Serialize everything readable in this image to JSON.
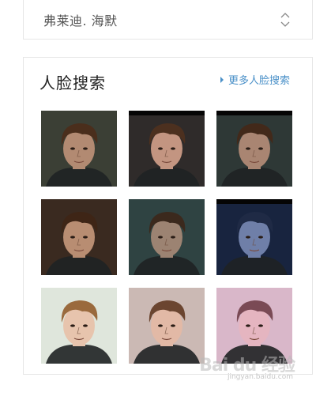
{
  "select": {
    "value": "弗莱迪. 海默",
    "icon": "sort-updown-icon"
  },
  "face_search": {
    "title": "人脸搜索",
    "more_label": "更多人脸搜索",
    "results": [
      {
        "tone": "dark-interior",
        "bg": "#3b3f35",
        "skin": "#b28a72",
        "hair": "#4a2e1c",
        "top_band": false
      },
      {
        "tone": "letterbox",
        "bg": "#2f2b2a",
        "skin": "#c39581",
        "hair": "#4c301f",
        "top_band": true
      },
      {
        "tone": "dark-teal",
        "bg": "#2e3836",
        "skin": "#a98572",
        "hair": "#42291a",
        "top_band": true
      },
      {
        "tone": "closeup-warm",
        "bg": "#3a2a20",
        "skin": "#b88d72",
        "hair": "#3e2516",
        "top_band": false
      },
      {
        "tone": "teal-interior",
        "bg": "#2f4342",
        "skin": "#9c8372",
        "hair": "#3b291d",
        "top_band": false
      },
      {
        "tone": "blue-night",
        "bg": "#18243f",
        "skin": "#6f7fa8",
        "hair": "#1f2a45",
        "top_band": true
      },
      {
        "tone": "washed-light",
        "bg": "#dfe6dc",
        "skin": "#e7c4ad",
        "hair": "#9a6a3d",
        "top_band": false
      },
      {
        "tone": "soft-pink",
        "bg": "#cbb9b4",
        "skin": "#e2b9a6",
        "hair": "#6b4530",
        "top_band": false
      },
      {
        "tone": "pink-tint",
        "bg": "#d9b7c9",
        "skin": "#e5b5c0",
        "hair": "#7a4a55",
        "top_band": false
      }
    ]
  },
  "watermark": {
    "main": "Bai du 经验",
    "sub": "jingyan.baidu.com"
  }
}
